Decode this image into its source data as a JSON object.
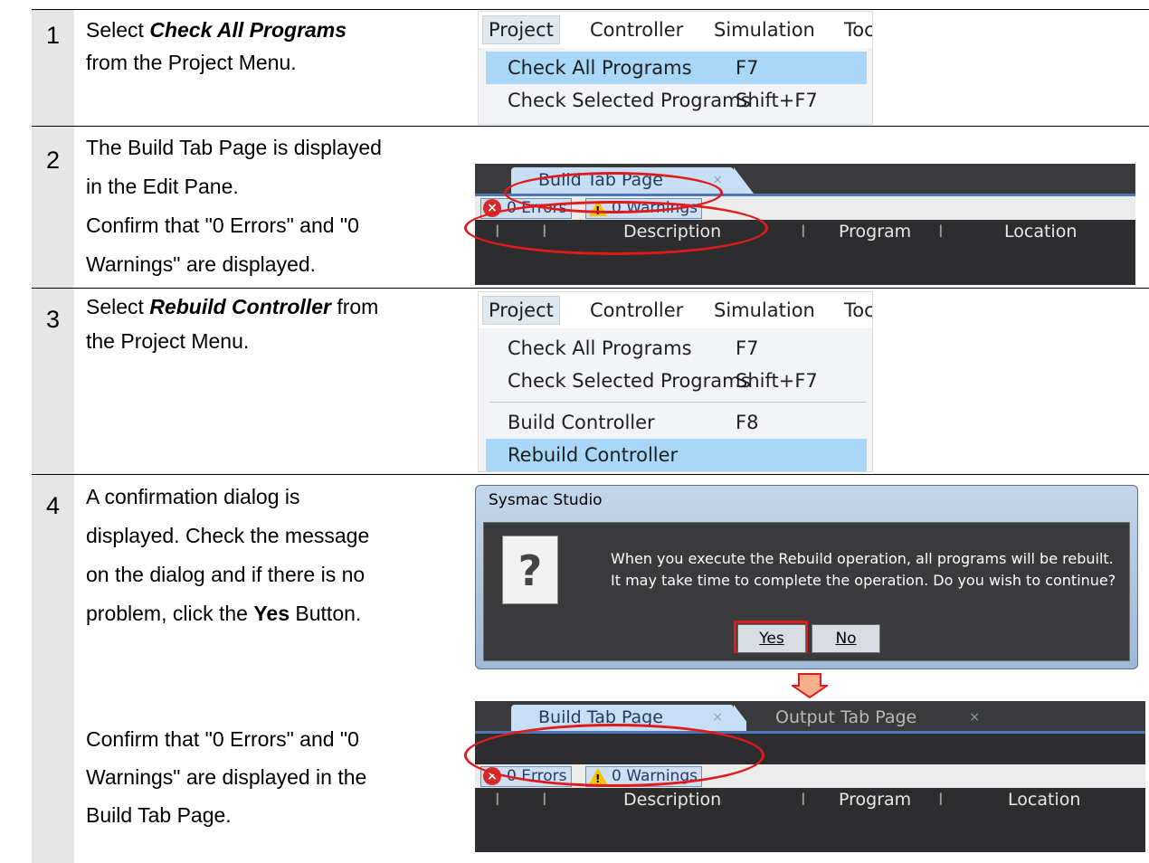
{
  "steps": [
    {
      "number": "1",
      "text_before": "Select ",
      "emph": "Check All Programs",
      "text_after": "from the Project Menu."
    },
    {
      "number": "2",
      "lines": [
        "The Build Tab Page is displayed",
        "in the Edit Pane.",
        "Confirm that \"0 Errors\" and \"0",
        "Warnings\" are displayed."
      ]
    },
    {
      "number": "3",
      "text_before": "Select ",
      "emph": "Rebuild Controller",
      "text_mid": " from",
      "text_after": "the Project Menu."
    },
    {
      "number": "4",
      "lines": [
        "A confirmation dialog is",
        "displayed. Check the message",
        "on the dialog and if there is no"
      ],
      "last_before": "problem, click the ",
      "last_bold": "Yes",
      "last_after": " Button.",
      "confirm_lines": [
        "Confirm that \"0 Errors\" and \"0",
        "Warnings\" are displayed in the",
        "Build Tab Page."
      ]
    }
  ],
  "menu": {
    "bar": [
      "Project",
      "Controller",
      "Simulation",
      "Toc"
    ],
    "items": [
      {
        "label": "Check All Programs",
        "shortcut": "F7"
      },
      {
        "label": "Check Selected Programs",
        "shortcut": "Shift+F7"
      },
      {
        "label": "Build Controller",
        "shortcut": "F8"
      },
      {
        "label": "Rebuild Controller",
        "shortcut": ""
      }
    ]
  },
  "build_pane": {
    "tab_build": "Build Tab Page",
    "tab_output": "Output Tab Page",
    "close": "×",
    "errors": "0  Errors",
    "warnings": "0  Warnings",
    "col_description": "Description",
    "col_program": "Program",
    "col_location": "Location",
    "col_sep": "I"
  },
  "dialog": {
    "title": "Sysmac Studio",
    "icon": "question-icon",
    "line1": "When you execute the Rebuild operation, all programs will be rebuilt.",
    "line2": "It may take time to complete the operation. Do you wish to continue?",
    "yes": "Yes",
    "no": "No"
  },
  "colors": {
    "highlight": "#a9d7f7",
    "annotation": "#e01b1b",
    "arrow": "#f7b08a"
  }
}
